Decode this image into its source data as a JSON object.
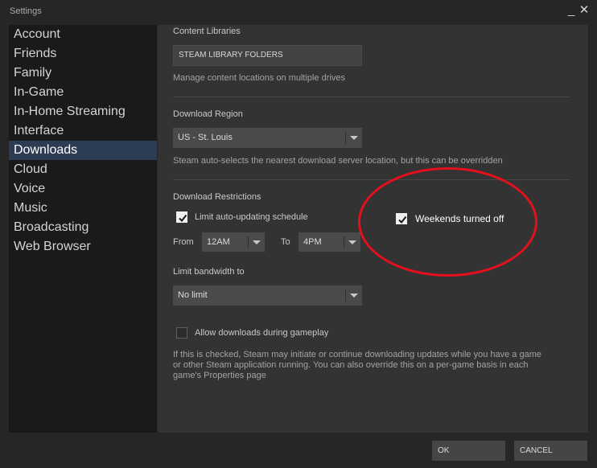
{
  "window": {
    "title": "Settings",
    "minimize_glyph": "_",
    "close_glyph": "✕"
  },
  "sidebar": {
    "items": [
      {
        "label": "Account"
      },
      {
        "label": "Friends"
      },
      {
        "label": "Family"
      },
      {
        "label": "In-Game"
      },
      {
        "label": "In-Home Streaming"
      },
      {
        "label": "Interface"
      },
      {
        "label": "Downloads",
        "active": true
      },
      {
        "label": "Cloud"
      },
      {
        "label": "Voice"
      },
      {
        "label": "Music"
      },
      {
        "label": "Broadcasting"
      },
      {
        "label": "Web Browser"
      }
    ]
  },
  "content_libraries": {
    "heading": "Content Libraries",
    "button_label": "STEAM LIBRARY FOLDERS",
    "description": "Manage content locations on multiple drives"
  },
  "download_region": {
    "heading": "Download Region",
    "selected": "US - St. Louis",
    "description": "Steam auto-selects the nearest download server location, but this can be overridden"
  },
  "download_restrictions": {
    "heading": "Download Restrictions",
    "limit_schedule_label": "Limit auto-updating schedule",
    "limit_schedule_checked": true,
    "from_label": "From",
    "from_value": "12AM",
    "to_label": "To",
    "to_value": "4PM",
    "bandwidth_label": "Limit bandwidth to",
    "bandwidth_value": "No limit",
    "gameplay_label": "Allow downloads during gameplay",
    "gameplay_checked": false,
    "gameplay_description": "If this is checked, Steam may initiate or continue downloading updates while you have a game or other Steam application running. You can also override this on a per-game basis in each game's Properties page"
  },
  "annotation": {
    "label": "Weekends turned off",
    "checked": true,
    "circle_color": "#e4101c"
  },
  "footer": {
    "ok_label": "OK",
    "cancel_label": "CANCEL"
  },
  "colors": {
    "active_nav": "#2c3d53",
    "panel": "#333333",
    "sidebar": "#1a1a1a"
  }
}
